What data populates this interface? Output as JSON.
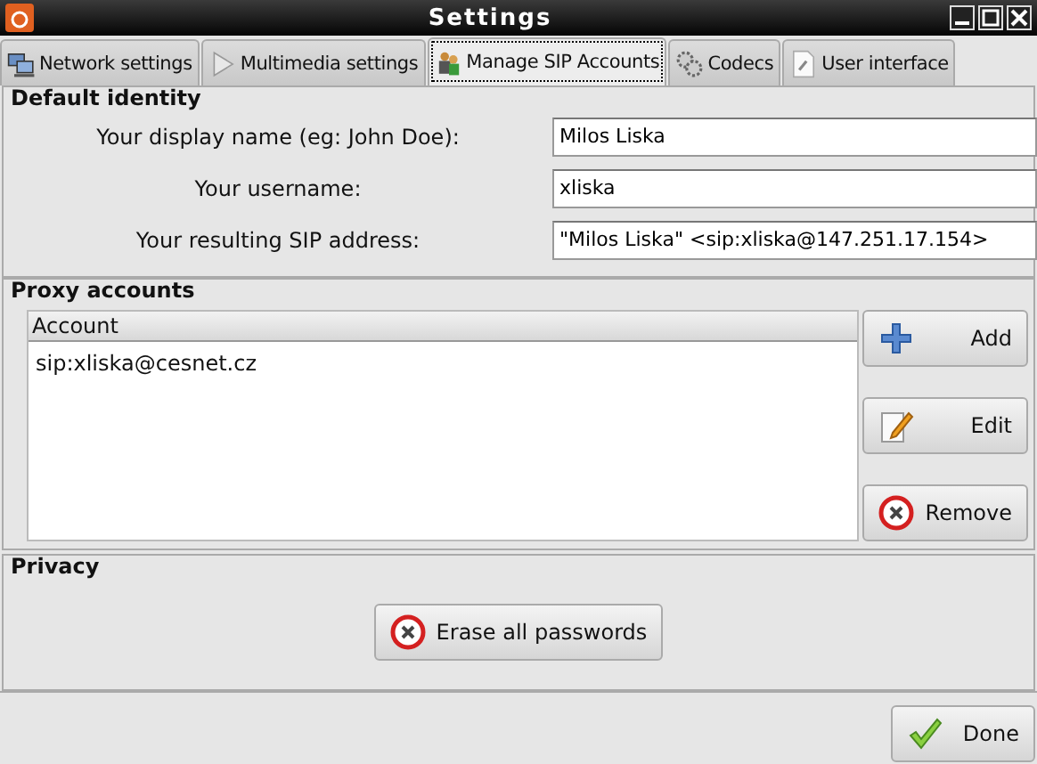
{
  "window": {
    "title": "Settings"
  },
  "tabs": [
    {
      "label": "Network settings",
      "selected": false
    },
    {
      "label": "Multimedia settings",
      "selected": false
    },
    {
      "label": "Manage SIP Accounts",
      "selected": true
    },
    {
      "label": "Codecs",
      "selected": false
    },
    {
      "label": "User interface",
      "selected": false
    }
  ],
  "default_identity": {
    "title": "Default identity",
    "fields": [
      {
        "label": "Your display name (eg: John Doe):",
        "value": "Milos Liska"
      },
      {
        "label": "Your username:",
        "value": "xliska"
      },
      {
        "label": "Your resulting SIP address:",
        "value": "\"Milos Liska\" <sip:xliska@147.251.17.154>"
      }
    ]
  },
  "proxy_accounts": {
    "title": "Proxy accounts",
    "table": {
      "columns": [
        "Account"
      ],
      "rows": [
        "sip:xliska@cesnet.cz"
      ]
    },
    "buttons": [
      "Add",
      "Edit",
      "Remove"
    ]
  },
  "privacy": {
    "title": "Privacy",
    "button": "Erase all passwords"
  },
  "footer": {
    "button": "Done"
  }
}
